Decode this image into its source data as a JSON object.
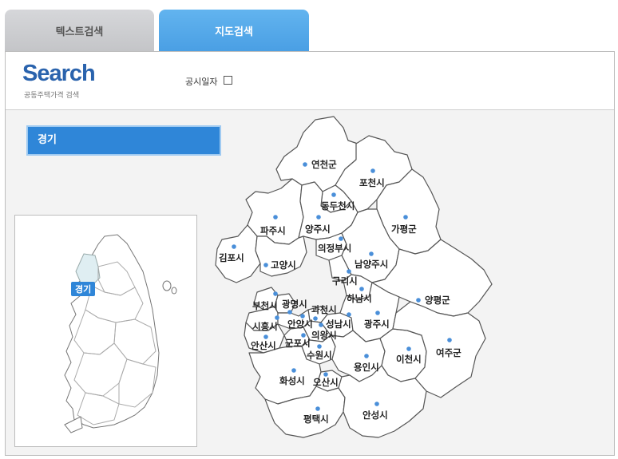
{
  "tabs": {
    "text_search": "텍스트검색",
    "map_search": "지도검색"
  },
  "header": {
    "logo": "Search",
    "subtitle": "공동주택가격 검색",
    "date_label": "공시일자"
  },
  "selected_region": "경기",
  "mini_map_label": "경기",
  "cities": {
    "yeoncheon": "연천군",
    "pocheon": "포천시",
    "dongducheon": "동두천시",
    "paju": "파주시",
    "yangju": "양주시",
    "gapyeong": "가평군",
    "gimpo": "김포시",
    "uijeongbu": "의정부시",
    "goyang": "고양시",
    "namyangju": "남양주시",
    "guri": "구리시",
    "hanam": "하남시",
    "yangpyeong": "양평군",
    "bucheon": "부천시",
    "gwangmyeong": "광명시",
    "gwacheon": "과천시",
    "siheung": "시흥시",
    "anyang": "안양시",
    "seongnam": "성남시",
    "gwangju": "광주시",
    "uiwang": "의왕시",
    "ansan": "안산시",
    "gunpo": "군포시",
    "suwon": "수원시",
    "icheon": "이천시",
    "yeoju": "여주군",
    "yongin": "용인시",
    "hwaseong": "화성시",
    "osan": "오산시",
    "pyeongtaek": "평택시",
    "anseong": "안성시"
  }
}
